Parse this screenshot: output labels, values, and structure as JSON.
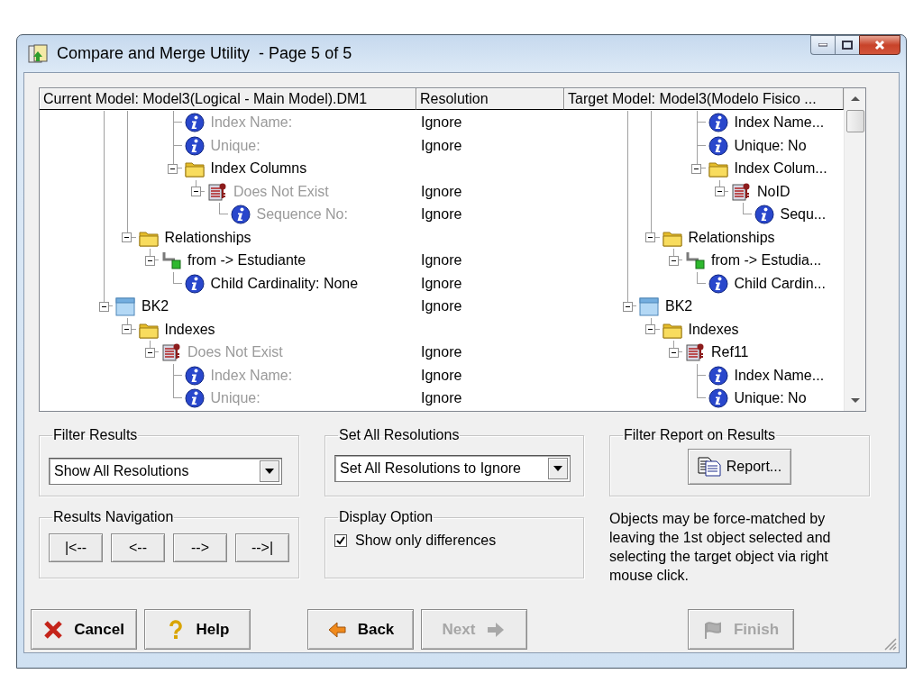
{
  "window": {
    "title": "Compare and Merge Utility  - Page 5 of 5"
  },
  "tree": {
    "columns": [
      "Current Model: Model3(Logical - Main Model).DM1",
      "Resolution",
      "Target Model: Model3(Modelo Fisico ..."
    ],
    "nodes": [
      {
        "children": [
          {
            "children": [
              {
                "children": [
                  {
                    "kind": "info",
                    "label": "Index Name:",
                    "greyed": true,
                    "resolution": "Ignore",
                    "target": "Index Name..."
                  },
                  {
                    "kind": "info",
                    "label": "Unique:",
                    "greyed": true,
                    "resolution": "Ignore",
                    "target": "Unique: No"
                  },
                  {
                    "kind": "folder",
                    "label": "Index Columns",
                    "greyed": false,
                    "expanded": true,
                    "target": "Index Colum...",
                    "children": [
                      {
                        "kind": "index",
                        "label": "Does Not Exist",
                        "greyed": true,
                        "expanded": true,
                        "resolution": "Ignore",
                        "target": "NoID",
                        "children": [
                          {
                            "kind": "info",
                            "label": "Sequence No:",
                            "greyed": true,
                            "resolution": "Ignore",
                            "target": "Sequ..."
                          }
                        ]
                      }
                    ]
                  }
                ]
              }
            ]
          },
          {
            "kind": "folder",
            "label": "Relationships",
            "greyed": false,
            "expanded": true,
            "target": "Relationships",
            "children": [
              {
                "kind": "relationship",
                "label": "from -> Estudiante",
                "greyed": false,
                "expanded": true,
                "resolution": "Ignore",
                "target": "from -> Estudia...",
                "children": [
                  {
                    "kind": "info",
                    "label": "Child Cardinality: None",
                    "greyed": false,
                    "resolution": "Ignore",
                    "target": "Child Cardin..."
                  }
                ]
              }
            ]
          }
        ]
      },
      {
        "kind": "entity",
        "label": "BK2",
        "greyed": false,
        "expanded": true,
        "resolution": "Ignore",
        "target": "BK2",
        "children": [
          {
            "kind": "folder",
            "label": "Indexes",
            "greyed": false,
            "expanded": true,
            "target": "Indexes",
            "children": [
              {
                "kind": "index",
                "label": "Does Not Exist",
                "greyed": true,
                "expanded": true,
                "resolution": "Ignore",
                "target": "Ref11",
                "children": [
                  {
                    "kind": "info",
                    "label": "Index Name:",
                    "greyed": true,
                    "resolution": "Ignore",
                    "target": "Index Name..."
                  },
                  {
                    "kind": "info",
                    "label": "Unique:",
                    "greyed": true,
                    "resolution": "Ignore",
                    "target": "Unique: No"
                  }
                ]
              }
            ]
          }
        ]
      }
    ]
  },
  "filter_results": {
    "title": "Filter Results",
    "value": "Show All Resolutions"
  },
  "set_all_resolutions": {
    "title": "Set All Resolutions",
    "value": "Set All Resolutions to Ignore"
  },
  "filter_report": {
    "title": "Filter Report on Results",
    "button": "Report..."
  },
  "results_navigation": {
    "title": "Results Navigation",
    "buttons": [
      "|<--",
      "<--",
      "-->",
      "-->|"
    ]
  },
  "display_option": {
    "title": "Display Option",
    "checkbox": {
      "label": "Show only differences",
      "checked": true
    }
  },
  "note": "Objects may be force-matched by leaving the 1st object selected and selecting the target object via right mouse click.",
  "buttons": [
    {
      "kind": "cancel",
      "label": "Cancel",
      "disabled": false
    },
    {
      "kind": "help",
      "label": "Help",
      "disabled": false
    },
    {
      "kind": "back",
      "label": "Back",
      "disabled": false
    },
    {
      "kind": "next",
      "label": "Next",
      "disabled": true
    },
    {
      "kind": "finish",
      "label": "Finish",
      "disabled": true
    }
  ]
}
